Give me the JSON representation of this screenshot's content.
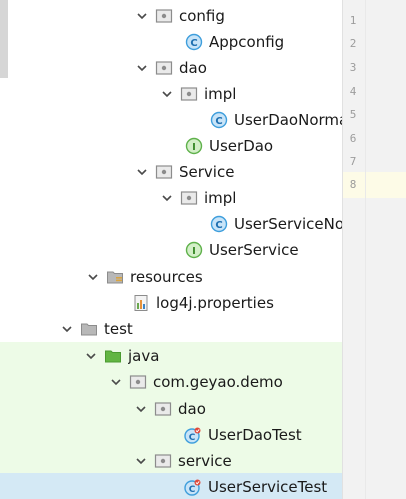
{
  "project_tree": {
    "nodes": [
      {
        "label": "config",
        "type": "package",
        "expanded": true
      },
      {
        "label": "Appconfig",
        "type": "class"
      },
      {
        "label": "dao",
        "type": "package",
        "expanded": true
      },
      {
        "label": "impl",
        "type": "package",
        "expanded": true
      },
      {
        "label": "UserDaoNorma",
        "type": "class"
      },
      {
        "label": "UserDao",
        "type": "interface"
      },
      {
        "label": "Service",
        "type": "package",
        "expanded": true
      },
      {
        "label": "impl",
        "type": "package",
        "expanded": true
      },
      {
        "label": "UserServiceNor",
        "type": "class"
      },
      {
        "label": "UserService",
        "type": "interface"
      },
      {
        "label": "resources",
        "type": "resources-folder",
        "expanded": true
      },
      {
        "label": "log4j.properties",
        "type": "properties-file"
      },
      {
        "label": "test",
        "type": "folder",
        "expanded": true
      },
      {
        "label": "java",
        "type": "test-source-folder",
        "expanded": true
      },
      {
        "label": "com.geyao.demo",
        "type": "package",
        "expanded": true
      },
      {
        "label": "dao",
        "type": "package",
        "expanded": true
      },
      {
        "label": "UserDaoTest",
        "type": "test-class"
      },
      {
        "label": "service",
        "type": "package",
        "expanded": true
      },
      {
        "label": "UserServiceTest",
        "type": "test-class",
        "selected": true
      }
    ]
  },
  "editor": {
    "line_numbers": [
      "1",
      "2",
      "3",
      "4",
      "5",
      "6",
      "7",
      "8"
    ],
    "current_line": "8"
  },
  "colors": {
    "test_highlight": "#edfbe7",
    "selection": "#d4e9f5",
    "class_icon": "#3e9edc",
    "interface_icon": "#5fb14b"
  }
}
